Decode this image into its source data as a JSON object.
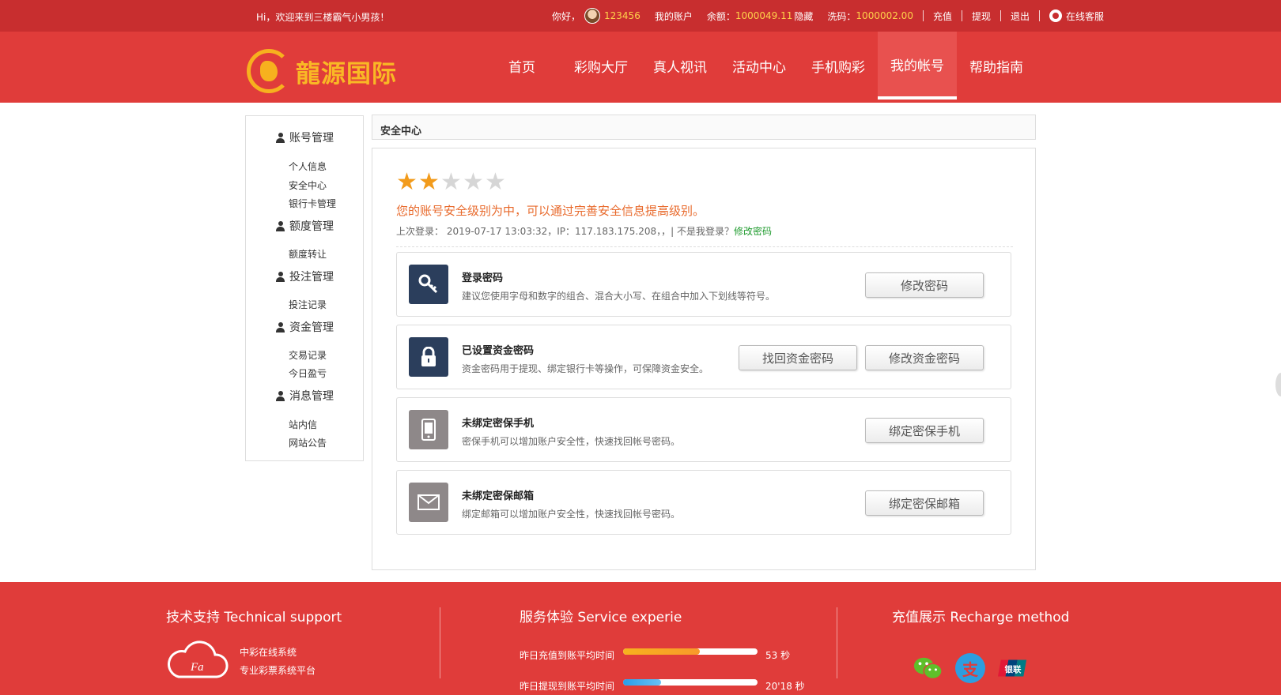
{
  "topbar": {
    "welcome": "Hi，欢迎来到三楼霸气小男孩！",
    "hello": "你好，",
    "username": "123456",
    "my_account": "我的账户",
    "balance_label": "余额：",
    "balance_value": "1000049.11",
    "hide": "隐藏",
    "wash_label": "洗码：",
    "wash_value": "1000002.00",
    "recharge": "充值",
    "withdraw": "提现",
    "logout": "退出",
    "online_service": "在线客服"
  },
  "header": {
    "logo_text": "龍源国际",
    "nav": [
      {
        "label": "首页"
      },
      {
        "label": "彩购大厅"
      },
      {
        "label": "真人视讯"
      },
      {
        "label": "活动中心"
      },
      {
        "label": "手机购彩"
      },
      {
        "label": "我的帐号"
      },
      {
        "label": "帮助指南"
      }
    ],
    "active_nav": "我的帐号"
  },
  "sidebar": {
    "groups": [
      {
        "label": "账号管理",
        "items": [
          "个人信息",
          "安全中心",
          "银行卡管理"
        ]
      },
      {
        "label": "额度管理",
        "items": [
          "额度转让"
        ]
      },
      {
        "label": "投注管理",
        "items": [
          "投注记录"
        ]
      },
      {
        "label": "资金管理",
        "items": [
          "交易记录",
          "今日盈亏"
        ]
      },
      {
        "label": "消息管理",
        "items": [
          "站内信",
          "网站公告"
        ]
      }
    ]
  },
  "main": {
    "breadcrumb": "安全中心",
    "rating": 2,
    "rating_max": 5,
    "level_text": "您的账号安全级别为中，可以通过完善安全信息提高级别。",
    "last_login": "上次登录： 2019-07-17 13:03:32，IP：117.183.175.208，，| 不是我登录？",
    "change_password_link": "修改密码",
    "cards": [
      {
        "icon": "key-icon",
        "title": "登录密码",
        "desc": "建议您使用字母和数字的组合、混合大小写、在组合中加入下划线等符号。",
        "buttons": [
          "修改密码"
        ]
      },
      {
        "icon": "lock-icon",
        "title": "已设置资金密码",
        "desc": "资金密码用于提现、绑定银行卡等操作，可保障资金安全。",
        "buttons": [
          "找回资金密码",
          "修改资金密码"
        ]
      },
      {
        "icon": "phone-icon",
        "title": "未绑定密保手机",
        "desc": "密保手机可以增加账户安全性，快速找回帐号密码。",
        "buttons": [
          "绑定密保手机"
        ]
      },
      {
        "icon": "mail-icon",
        "title": "未绑定密保邮箱",
        "desc": "绑定邮箱可以增加账户安全性，快速找回帐号密码。",
        "buttons": [
          "绑定密保邮箱"
        ]
      }
    ]
  },
  "footer": {
    "tech_title": "技术支持 Technical support",
    "tech_line1": "中彩在线系统",
    "tech_line2": "专业彩票系统平台",
    "service_title": "服务体验 Service experie",
    "stat1_label": "昨日充值到账平均时间",
    "stat1_value": "53 秒",
    "stat1_fill": 0.57,
    "stat2_label": "昨日提现到账平均时间",
    "stat2_value": "20'18 秒",
    "stat2_fill": 0.28,
    "recharge_title": "充值展示 Recharge method",
    "pay_methods": [
      "wechat-icon",
      "alipay-icon",
      "unionpay-icon"
    ],
    "alipay_char": "支",
    "unionpay_text": "银联"
  },
  "colors": {
    "topbar": "#c82e2f",
    "header": "#e03c3a",
    "accent_yellow": "#ffd24a",
    "warning_text": "#e8692b",
    "star_on": "#f29b1b"
  }
}
